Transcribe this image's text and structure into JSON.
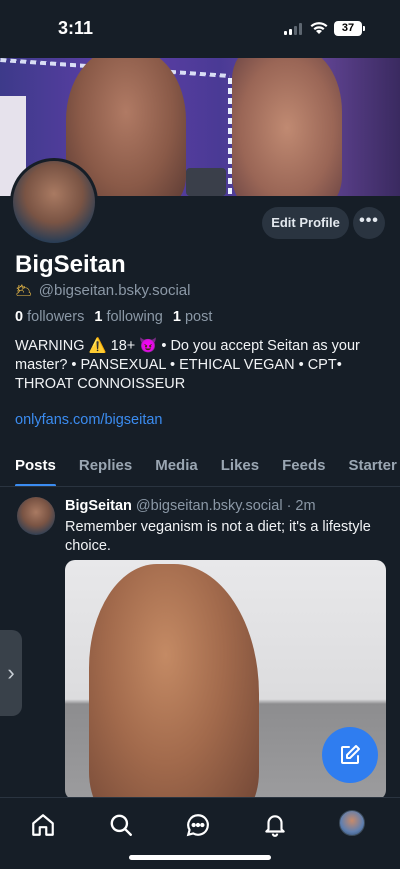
{
  "status": {
    "time": "3:11",
    "battery": "37"
  },
  "profile": {
    "display_name": "BigSeitan",
    "handle_emoji": "🌥",
    "handle": "@bigseitan.bsky.social",
    "followers_count": "0",
    "followers_label": "followers",
    "following_count": "1",
    "following_label": "following",
    "posts_count": "1",
    "posts_label": "post",
    "bio": "WARNING ⚠️ 18+ 😈 • Do you accept Seitan as your master? • PANSEXUAL • ETHICAL VEGAN • CPT• THROAT CONNOISSEUR",
    "link": "onlyfans.com/bigseitan",
    "edit_label": "Edit Profile",
    "more_label": "•••"
  },
  "tabs": [
    "Posts",
    "Replies",
    "Media",
    "Likes",
    "Feeds",
    "Starter Packs"
  ],
  "post": {
    "author": "BigSeitan",
    "handle": "@bigseitan.bsky.social",
    "time": "· 2m",
    "text": "Remember veganism is not a diet; it's a lifestyle choice."
  },
  "side_handle": "›",
  "icons": {
    "nav": [
      "home-icon",
      "search-icon",
      "chat-icon",
      "bell-icon",
      "avatar"
    ],
    "compose": "compose-icon"
  }
}
